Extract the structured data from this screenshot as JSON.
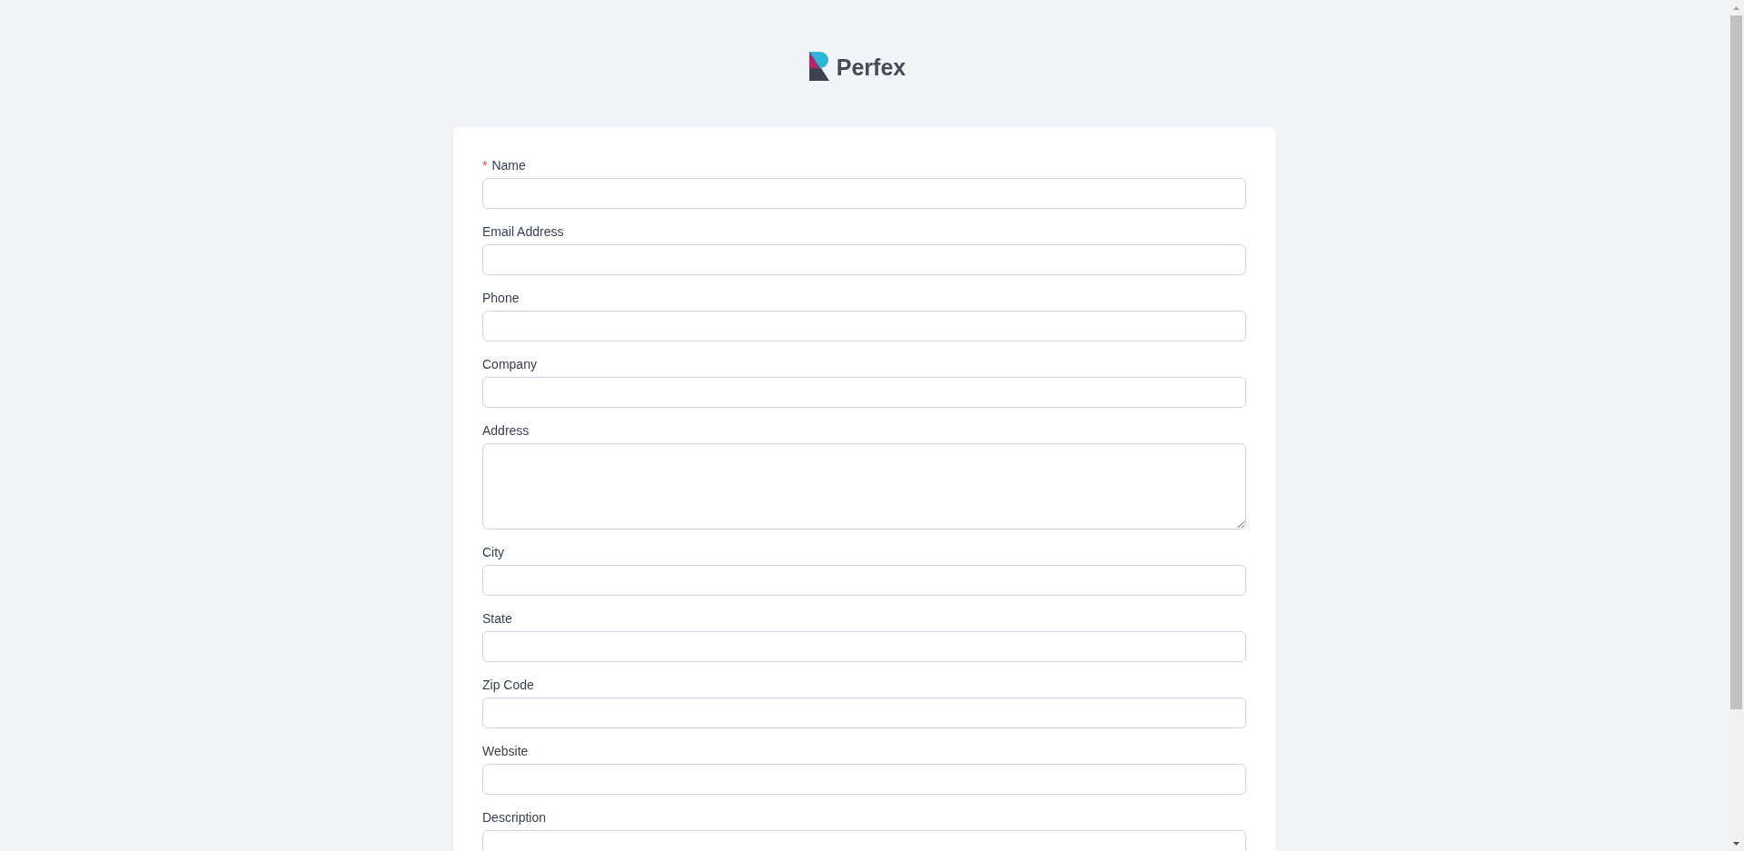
{
  "logo": {
    "text": "Perfex"
  },
  "form": {
    "fields": [
      {
        "label": "Name",
        "mark": "*",
        "kind": "input"
      },
      {
        "label": "Email Address",
        "kind": "input"
      },
      {
        "label": "Phone",
        "kind": "input"
      },
      {
        "label": "Company",
        "kind": "input"
      },
      {
        "label": "Address",
        "kind": "textarea"
      },
      {
        "label": "City",
        "kind": "input"
      },
      {
        "label": "State",
        "kind": "input"
      },
      {
        "label": "Zip Code",
        "kind": "input"
      },
      {
        "label": "Website",
        "kind": "input"
      },
      {
        "label": "Description",
        "kind": "input"
      }
    ]
  }
}
